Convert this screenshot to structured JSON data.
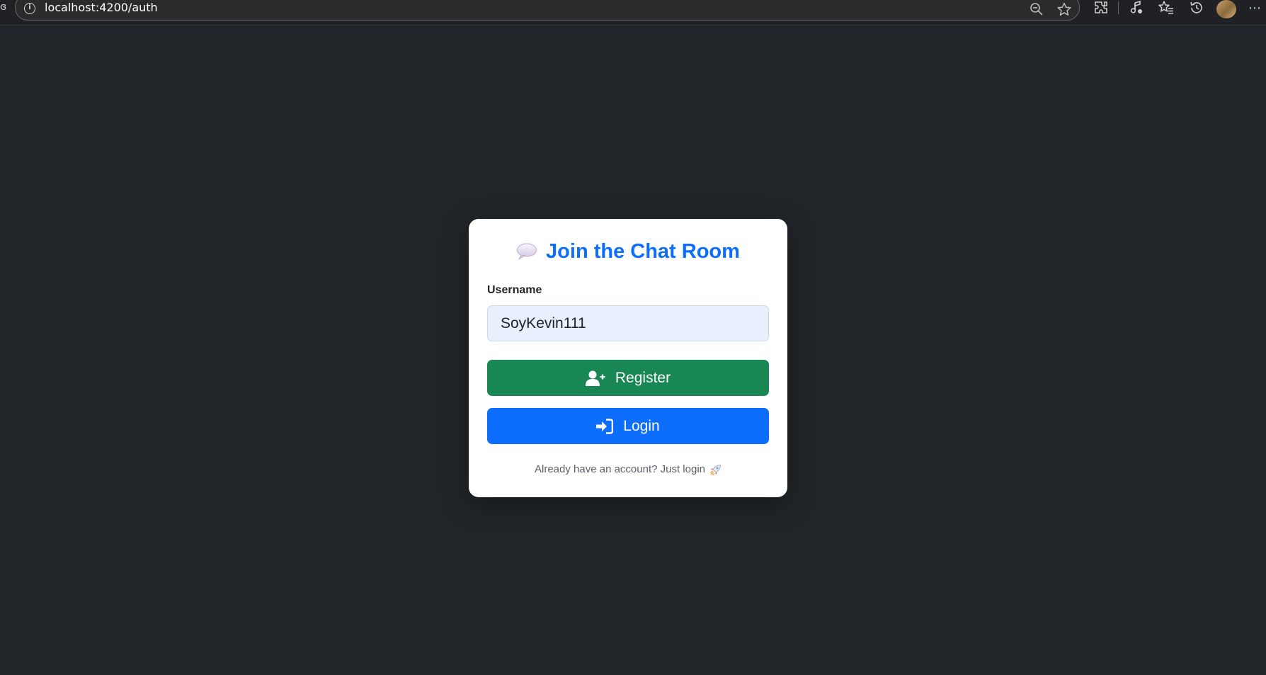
{
  "browser": {
    "url": "localhost:4200/auth",
    "icons": [
      "info-icon",
      "zoom-out-icon",
      "star-icon",
      "extensions-icon",
      "media-icon",
      "favorites-icon",
      "history-icon",
      "profile-avatar",
      "more-icon"
    ]
  },
  "card": {
    "title": "Join the Chat Room",
    "title_icon": "speech-bubble-icon",
    "username_label": "Username",
    "username_value": "SoyKevin111",
    "register_label": "Register",
    "register_icon": "user-plus-icon",
    "login_label": "Login",
    "login_icon": "sign-in-icon",
    "footer_text": "Already have an account? Just login",
    "footer_icon": "rocket-icon"
  },
  "colors": {
    "page_bg": "#212529",
    "card_bg": "#ffffff",
    "title": "#0d6efd",
    "register_btn": "#198754",
    "login_btn": "#0d6efd",
    "input_bg": "#e8f0fe"
  }
}
